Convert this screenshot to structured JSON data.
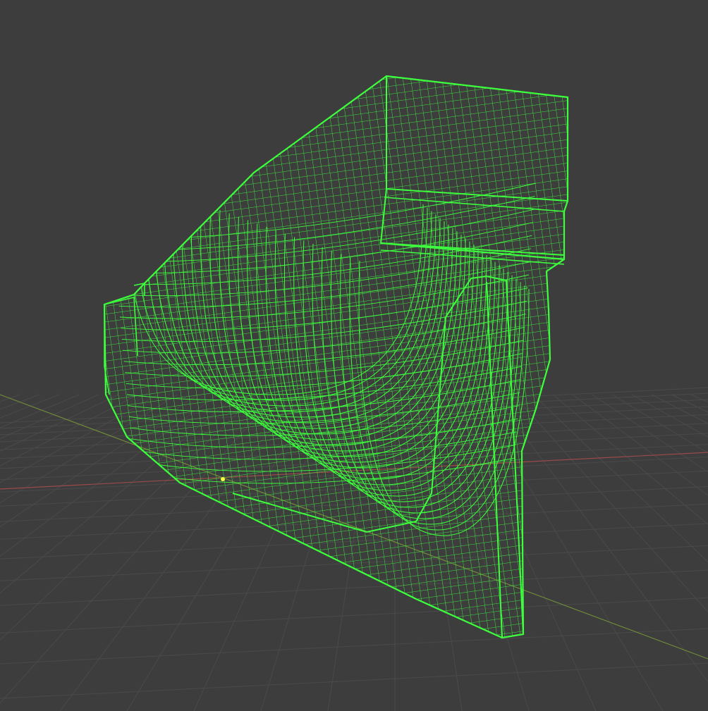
{
  "viewport": {
    "background_color": "#3d3d3d",
    "grid_color": "#4a4a4a",
    "x_axis_color": "#9a4a4a",
    "y_axis_color": "#6f8a3a",
    "wire_color": "#3dff3d",
    "selection_color": "#f5ff3d",
    "view": "perspective",
    "shading_mode": "wireframe",
    "object": "ship-hull-mesh",
    "selected_vertex_count": 1
  }
}
